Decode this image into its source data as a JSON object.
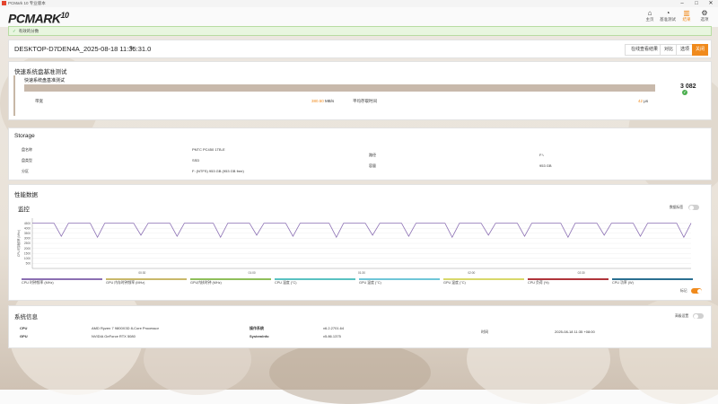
{
  "window": {
    "title": "PCMark 10 专业版本"
  },
  "brand": {
    "name": "PCMARK",
    "version": "10"
  },
  "nav": [
    {
      "label": "主页",
      "icon": "home-icon"
    },
    {
      "label": "基准测试",
      "icon": "gauge-icon"
    },
    {
      "label": "结果",
      "icon": "bar-chart-icon"
    },
    {
      "label": "选项",
      "icon": "gear-icon"
    }
  ],
  "notice": {
    "text": "有效的分数"
  },
  "result": {
    "title": "DESKTOP-D7DEN4A_2025-08-18 11:35:31.0",
    "buttons": {
      "online": "在线查看结果",
      "compare": "对比",
      "options": "选项",
      "close": "关闭"
    }
  },
  "quick": {
    "section_title": "快速系统盘基准测试",
    "label": "快速系统盘基准测试",
    "score": "3 082",
    "bandwidth_label": "带宽",
    "bandwidth_value": "380.50",
    "bandwidth_unit": "MB/s",
    "latency_label": "平均存取时间",
    "latency_value": "42",
    "latency_unit": "μs"
  },
  "storage": {
    "title": "Storage",
    "rows": [
      {
        "label": "盘名称",
        "value": "PNTC PC450 1TB-E"
      },
      {
        "label": "盘类型",
        "value": "SSD"
      },
      {
        "label": "分区",
        "value": "F: (NTFS) 953 GB (953 GB free)"
      }
    ],
    "right": [
      {
        "label": "路径",
        "value": "F:\\"
      },
      {
        "label": "容量",
        "value": "953 GB"
      }
    ]
  },
  "perf": {
    "title": "性能数据",
    "monitor_title": "监控",
    "toggle_top": "数据标签",
    "toggle_bottom": "标记",
    "legend": [
      {
        "label": "CPU 时钟频率 (MHz)",
        "color": "#8b6fb3"
      },
      {
        "label": "GPU 内存时钟频率 (MHz)",
        "color": "#c9b86a"
      },
      {
        "label": "GPU内核时钟 (MHz)",
        "color": "#8fbf5a"
      },
      {
        "label": "CPU 温度 (°C)",
        "color": "#59c2c2"
      },
      {
        "label": "GPU 温度 (°C)",
        "color": "#6fc6d8"
      },
      {
        "label": "GPU 温度 (°C)",
        "color": "#d8d86a"
      },
      {
        "label": "CPU 负荷 (%)",
        "color": "#b0343a"
      },
      {
        "label": "CPU 功率 (W)",
        "color": "#2a6f91"
      }
    ]
  },
  "chart_data": {
    "type": "line",
    "title": "",
    "xlabel": "",
    "ylabel": "CPU 时钟频率 (MHz)",
    "x_ticks": [
      "00:30",
      "01:00",
      "01:30",
      "02:00",
      "02:30"
    ],
    "y_ticks": [
      "4500",
      "4000",
      "3500",
      "3000",
      "2500",
      "2000",
      "1500",
      "1000",
      "500"
    ],
    "ylim": [
      0,
      5000
    ],
    "xlim": [
      0,
      180
    ],
    "series": [
      {
        "values": [
          4500,
          4500,
          4500,
          4500,
          3200,
          4500,
          4500,
          4500,
          4500,
          3100,
          4500,
          4500,
          4500,
          4500,
          4500,
          3300,
          4500,
          4500,
          4500,
          4500,
          3200,
          4500,
          4500,
          4500,
          4500,
          4500,
          3100,
          4500,
          4500,
          4500,
          4500,
          3300,
          4500,
          4500,
          4500,
          4500,
          3200,
          4500,
          4500,
          4500,
          4500,
          4500,
          3100,
          4500,
          4500,
          4500,
          4500,
          3300,
          4500,
          4500,
          4500,
          4500,
          3200,
          4500,
          4500,
          4500,
          4500,
          4500,
          3100,
          4500,
          4500,
          4500,
          4500,
          3300,
          4500,
          4500,
          4500,
          4500,
          3200,
          4500,
          4500,
          4500,
          4500,
          4500,
          3100,
          4500,
          4500,
          4500,
          4500,
          3300,
          4500,
          4500,
          4500,
          4500,
          3200,
          4500,
          4500,
          4500,
          4500,
          4500,
          3100,
          4500
        ]
      }
    ]
  },
  "sysinfo": {
    "title": "系统信息",
    "toggle": "高级设置",
    "cpu_label": "CPU",
    "cpu_value": "AMD Ryzen 7 9800X3D 8-Core Processor",
    "gpu_label": "GPU",
    "gpu_value": "NVIDIA GeForce RTX 5080",
    "os_label": "操作系统",
    "os_value": "v6.2.2701.64",
    "sysinfo_label": "SystemInfo",
    "sysinfo_value": "v5.86.1375",
    "time_label": "时间",
    "time_value": "2025-08-18 11:35 +08:00"
  }
}
